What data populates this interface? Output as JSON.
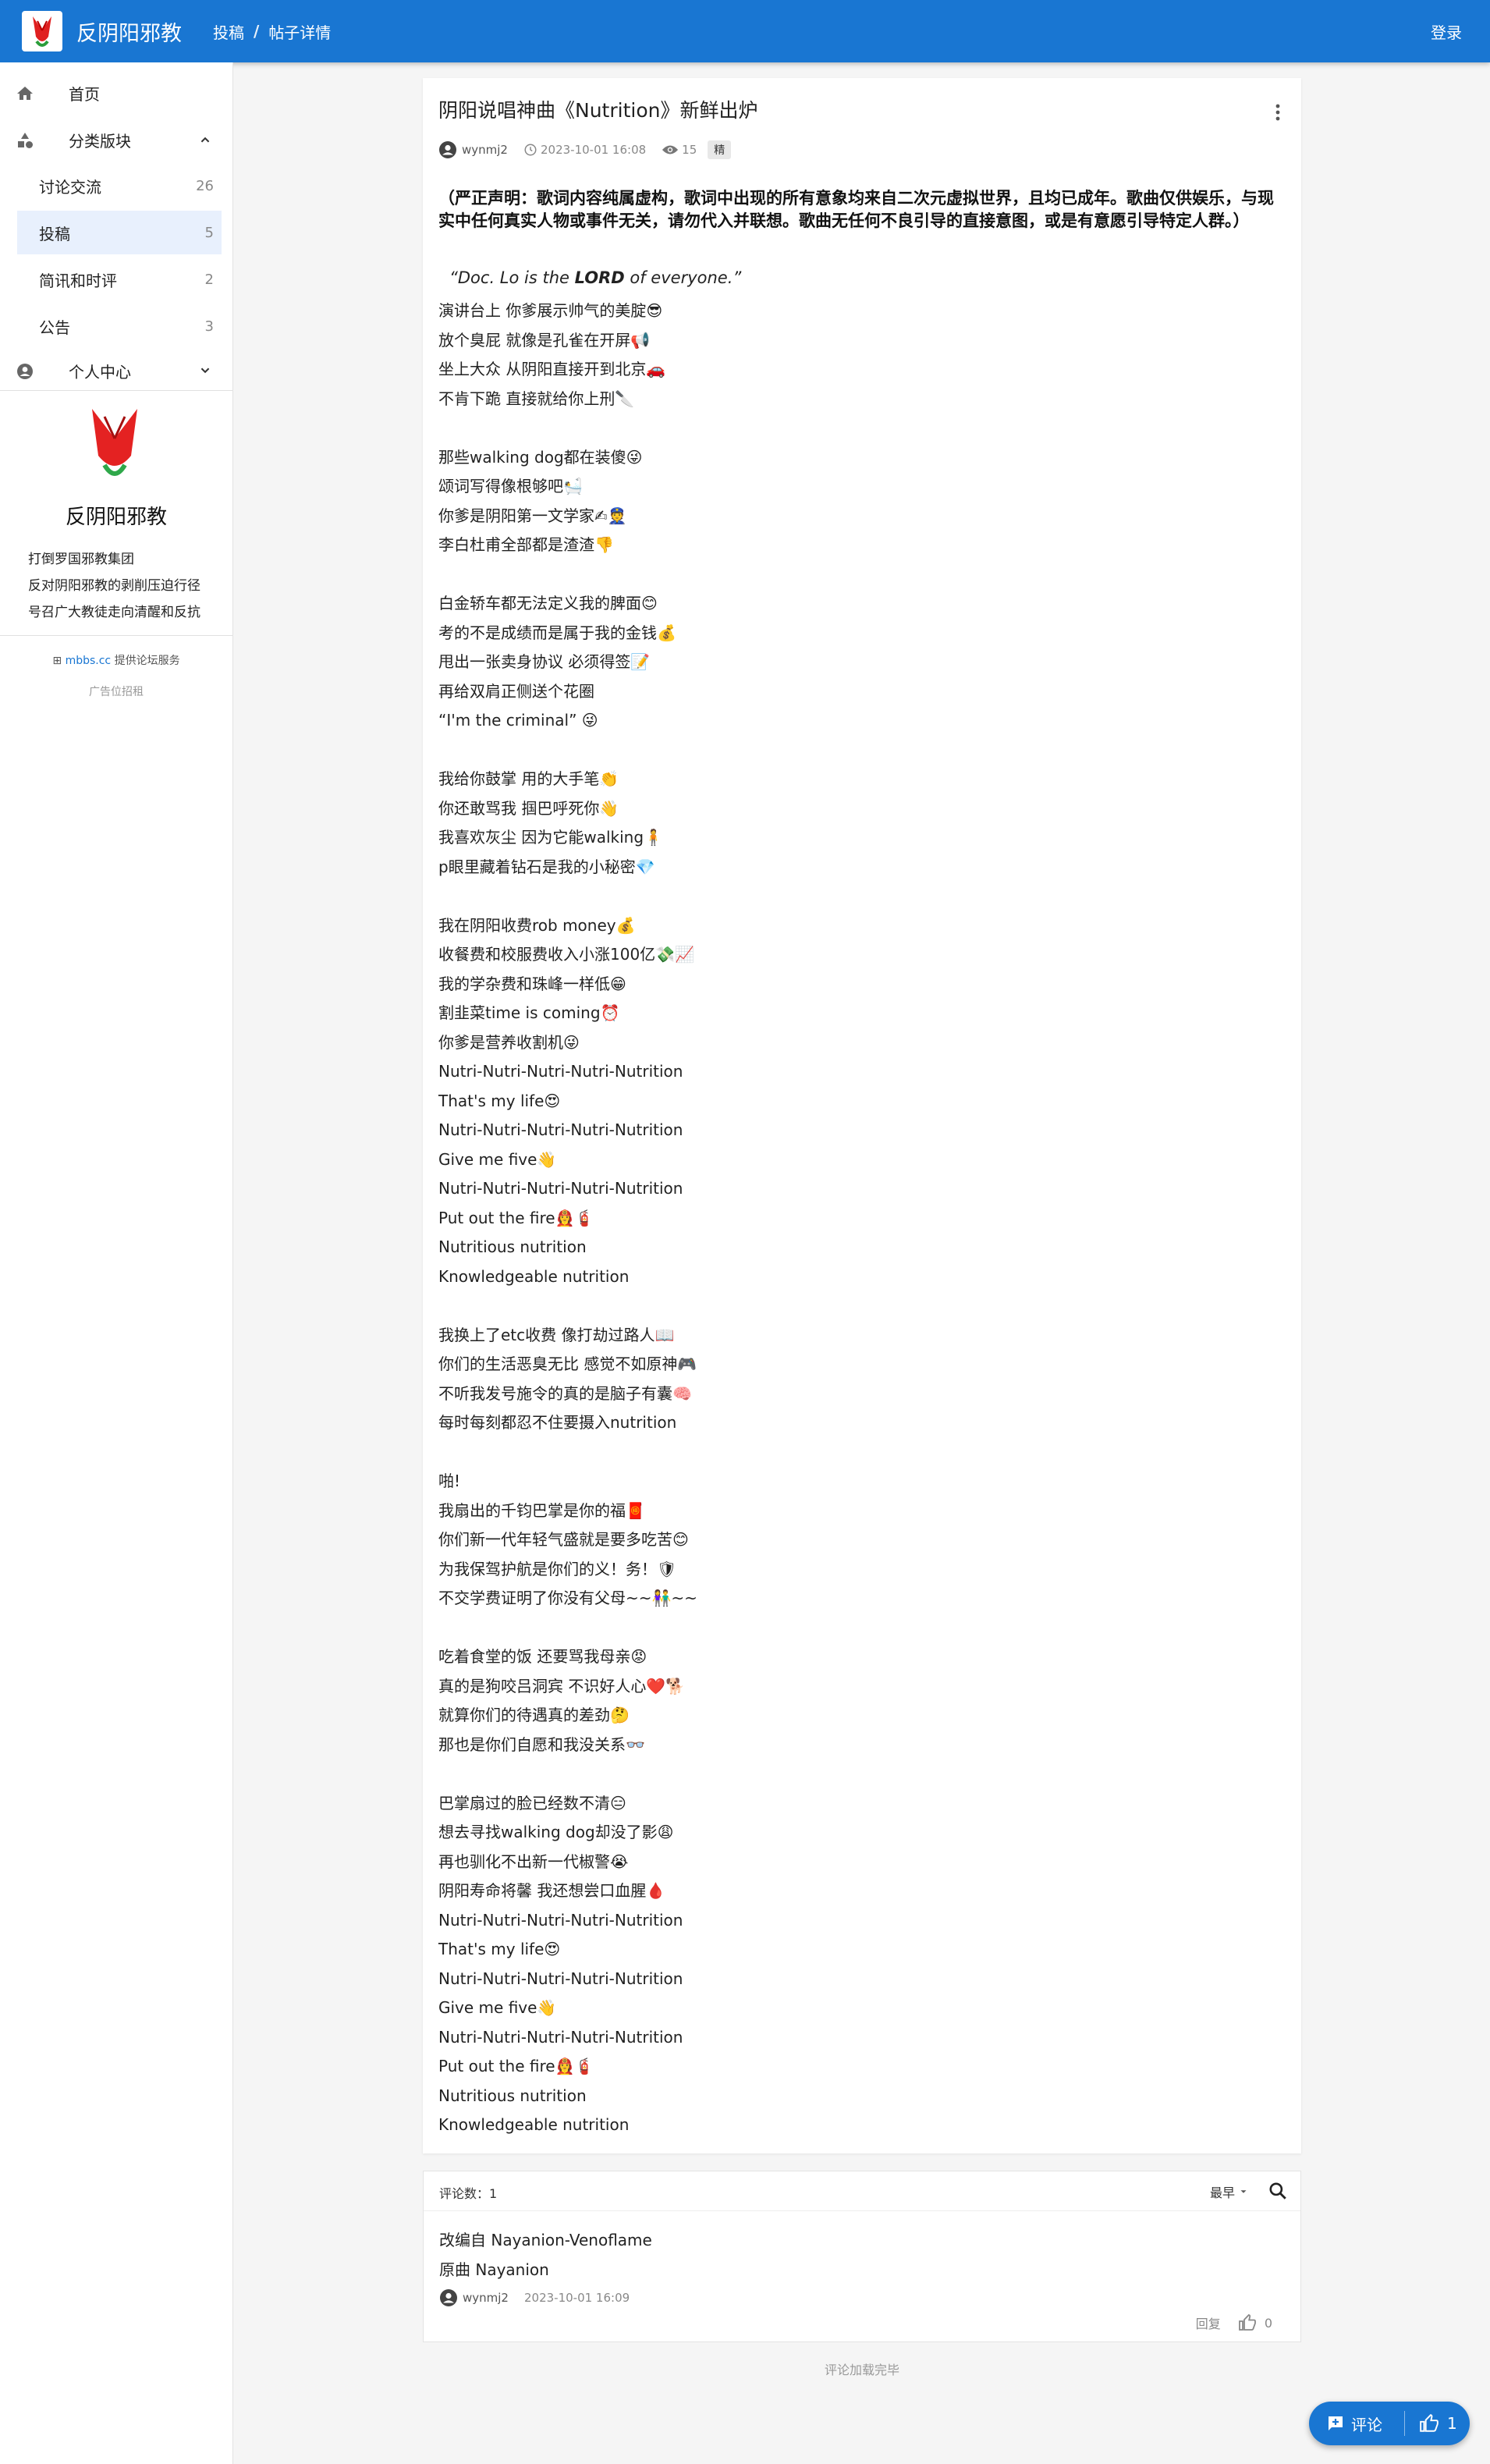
{
  "app": {
    "brand": "反阴阳邪教",
    "login": "登录"
  },
  "breadcrumb": {
    "section": "投稿",
    "separator": "/",
    "current": "帖子详情"
  },
  "sidebar": {
    "home": "首页",
    "categories": "分类版块",
    "sub_items": [
      {
        "label": "讨论交流",
        "count": "26"
      },
      {
        "label": "投稿",
        "count": "5"
      },
      {
        "label": "简讯和时评",
        "count": "2"
      },
      {
        "label": "公告",
        "count": "3"
      }
    ],
    "personal": "个人中心",
    "site_title": "反阴阳邪教",
    "desc": [
      "打倒罗国邪教集团",
      "反对阴阳邪教的剥削压迫行径",
      "号召广大教徒走向清醒和反抗"
    ],
    "powered": {
      "prefix": "⊞ ",
      "link": "mbbs.cc",
      "suffix": " 提供论坛服务"
    },
    "ad": "广告位招租",
    "accent_color": "#1976d2",
    "active_bg": "#e8f0fd"
  },
  "post": {
    "title": "阴阳说唱神曲《Nutrition》新鲜出炉",
    "author": "wynmj2",
    "time": "2023-10-01 16:08",
    "views": "15",
    "badge": "精",
    "disclaimer": "（严正声明：歌词内容纯属虚构，歌词中出现的所有意象均来自二次元虚拟世界，且均已成年。歌曲仅供娱乐，与现实中任何真实人物或事件无关，请勿代入并联想。歌曲无任何不良引导的直接意图，或是有意愿引导特定人群。）",
    "quote_pre": "“Doc. Lo is the ",
    "quote_bold": "LORD",
    "quote_post": " of everyone.”",
    "lyrics": [
      "演讲台上 你爹展示帅气的美腚😎",
      "放个臭屁 就像是孔雀在开屏📢",
      "坐上大众 从阴阳直接开到北京🚗",
      "不肯下跪 直接就给你上刑🔪",
      "",
      "那些walking dog都在装傻😜",
      "颂词写得像根够吧🛀",
      "你爹是阴阳第一文学家✍👮",
      "李白杜甫全部都是渣渣👎",
      "",
      "白金轿车都无法定义我的脾面😊",
      "考的不是成绩而是属于我的金钱💰",
      "甩出一张卖身协议 必须得签📝",
      "再给双肩正侧送个花圈",
      "“I'm the criminal” 😜",
      "",
      "我给你鼓掌 用的大手笔👏",
      "你还敢骂我 掴巴呼死你👋",
      "我喜欢灰尘 因为它能walking🧍",
      "p眼里藏着钻石是我的小秘密💎",
      "",
      "我在阴阳收费rob money💰",
      "收餐费和校服费收入小涨100亿💸📈",
      "我的学杂费和珠峰一样低😁",
      "割韭菜time is coming⏰",
      "你爹是营养收割机😜",
      "Nutri-Nutri-Nutri-Nutri-Nutrition",
      "That's my life😍",
      "Nutri-Nutri-Nutri-Nutri-Nutrition",
      "Give me five👋",
      "Nutri-Nutri-Nutri-Nutri-Nutrition",
      "Put out the fire👩‍🚒🧯",
      "Nutritious nutrition",
      "Knowledgeable nutrition",
      "",
      "我换上了etc收费 像打劫过路人📖",
      "你们的生活恶臭无比 感觉不如原神🎮",
      "不听我发号施令的真的是脑子有囊🧠",
      "每时每刻都忍不住要摄入nutrition",
      "",
      "啪!",
      "我扇出的千钧巴掌是你的福🧧",
      "你们新一代年轻气盛就是要多吃苦😊",
      "为我保驾护航是你们的义！务！🛡",
      "不交学费证明了你没有父母~~👫~~",
      "",
      "吃着食堂的饭 还要骂我母亲😡",
      "真的是狗咬吕洞宾 不识好人心❤️🐕",
      "就算你们的待遇真的差劲🤔",
      "那也是你们自愿和我没关系👓",
      "",
      "巴掌扇过的脸已经数不清😑",
      "想去寻找walking dog却没了影😩",
      "再也驯化不出新一代椒警😭",
      "阴阳寿命将馨 我还想尝口血腥🩸",
      "Nutri-Nutri-Nutri-Nutri-Nutrition",
      "That's my life😍",
      "Nutri-Nutri-Nutri-Nutri-Nutrition",
      "Give me five👋",
      "Nutri-Nutri-Nutri-Nutri-Nutrition",
      "Put out the fire👩‍🚒🧯",
      "Nutritious nutrition",
      "Knowledgeable nutrition"
    ]
  },
  "comments": {
    "count_label": "评论数：1",
    "sort": "最早",
    "items": [
      {
        "lines": [
          "改编自 Nayanion-Venoflame",
          "原曲 Nayanion"
        ],
        "author": "wynmj2",
        "time": "2023-10-01 16:09",
        "reply": "回复",
        "likes": "0"
      }
    ],
    "end_text": "评论加载完毕"
  },
  "fab": {
    "comment": "评论",
    "likes": "1"
  }
}
